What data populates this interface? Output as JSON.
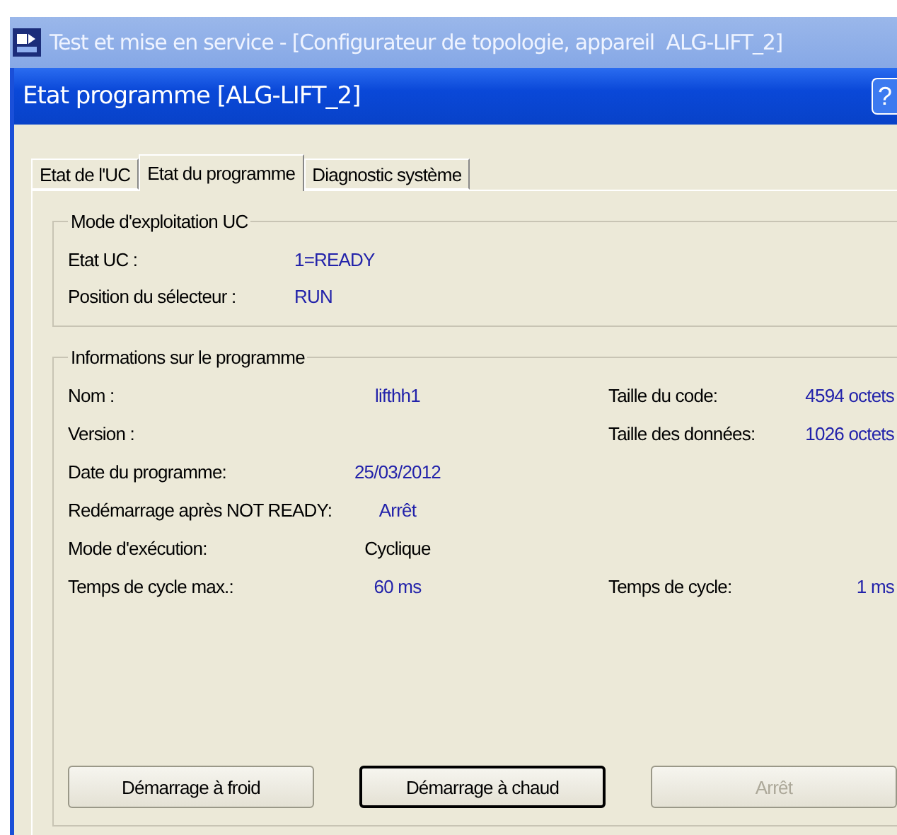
{
  "app_window": {
    "title": "Test et mise en service - [Configurateur de topologie, appareil  ALG-LIFT_2]"
  },
  "dialog": {
    "title": "Etat programme [ALG-LIFT_2]",
    "help_button": "?"
  },
  "tabs": [
    {
      "label": "Etat de l'UC",
      "selected": false
    },
    {
      "label": "Etat du programme",
      "selected": true
    },
    {
      "label": "Diagnostic système",
      "selected": false
    }
  ],
  "mode_group": {
    "title": "Mode d'exploitation UC",
    "rows": [
      {
        "label": "Etat UC :",
        "value": "1=READY",
        "color": "#2222aa"
      },
      {
        "label": "Position du sélecteur :",
        "value": "RUN",
        "color": "#2222aa"
      }
    ]
  },
  "info_group": {
    "title": "Informations sur le programme",
    "rows": [
      {
        "label": "Nom :",
        "value": "lifthh1",
        "color": "#2222aa",
        "right_label": "Taille du code:",
        "right_value": "4594 octets"
      },
      {
        "label": "Version :",
        "right_label": "Taille des données:",
        "right_value": "1026 octets"
      },
      {
        "label": "Date du programme:",
        "value": "25/03/2012",
        "color": "#2222aa"
      },
      {
        "label": "Redémarrage après NOT READY:",
        "value": "Arrêt",
        "color": "#2222aa"
      },
      {
        "label": "Mode d'exécution:",
        "value": "Cyclique",
        "color": "#000000"
      },
      {
        "label": "Temps de cycle max.:",
        "value": "60 ms",
        "color": "#2222aa",
        "right_label": "Temps de cycle:",
        "right_value": "1 ms"
      }
    ]
  },
  "buttons": [
    {
      "label": "Démarrage à froid",
      "default": false,
      "disabled": false
    },
    {
      "label": "Démarrage à chaud",
      "default": true,
      "disabled": false
    },
    {
      "label": "Arrêt",
      "default": false,
      "disabled": true
    }
  ]
}
